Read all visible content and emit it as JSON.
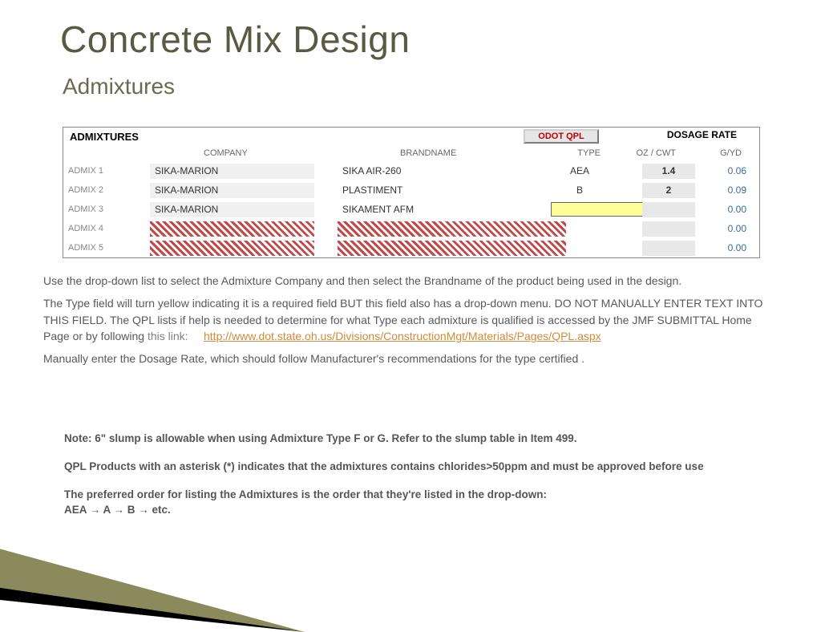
{
  "title": "Concrete Mix Design",
  "subtitle": "Admixtures",
  "panel": {
    "section_label": "ADMIXTURES",
    "qpl_button": "ODOT QPL",
    "dosage_header": "DOSAGE RATE",
    "cols": {
      "company": "COMPANY",
      "brand": "BRANDNAME",
      "type": "TYPE",
      "oz": "OZ / CWT",
      "gyd": "G/YD"
    },
    "rows": [
      {
        "label": "ADMIX 1",
        "company": "SIKA-MARION",
        "brand": "SIKA AIR-260",
        "type": "AEA",
        "oz": "1.4",
        "gyd": "0.06"
      },
      {
        "label": "ADMIX 2",
        "company": "SIKA-MARION",
        "brand": "PLASTIMENT",
        "type": "B",
        "oz": "2",
        "gyd": "0.09"
      },
      {
        "label": "ADMIX 3",
        "company": "SIKA-MARION",
        "brand": "SIKAMENT AFM",
        "type": "",
        "oz": "",
        "gyd": "0.00"
      },
      {
        "label": "ADMIX 4",
        "company": "",
        "brand": "",
        "type": "",
        "oz": "",
        "gyd": "0.00"
      },
      {
        "label": "ADMIX 5",
        "company": "",
        "brand": "",
        "type": "",
        "oz": "",
        "gyd": "0.00"
      }
    ]
  },
  "body": {
    "p1": "Use the drop-down list to select the  Admixture Company and then select the Brandname of the product being used in the design.",
    "p2": "The Type field will turn yellow indicating it is a required field BUT this field also has a drop-down menu. DO NOT MANUALLY ENTER TEXT INTO THIS FIELD. The QPL lists if help is needed to determine for what Type each admixture is qualified is accessed by the JMF SUBMITTAL Home Page or by following",
    "link_label": "this link:",
    "link_url": "http://www.dot.state.oh.us/Divisions/ConstructionMgt/Materials/Pages/QPL.aspx",
    "p3": "Manually enter the Dosage Rate, which should follow Manufacturer's recommendations for the type certified ."
  },
  "notes": {
    "n1": "Note: 6\" slump is allowable when using Admixture Type F or G. Refer to the slump table in Item 499.",
    "n2": "QPL Products with an asterisk (*) indicates that the admixtures contains chlorides>50ppm and must be approved before use",
    "n3": "The preferred order for listing the Admixtures is the order that they're listed in the drop-down:",
    "n4": "AEA → A → B → etc."
  }
}
